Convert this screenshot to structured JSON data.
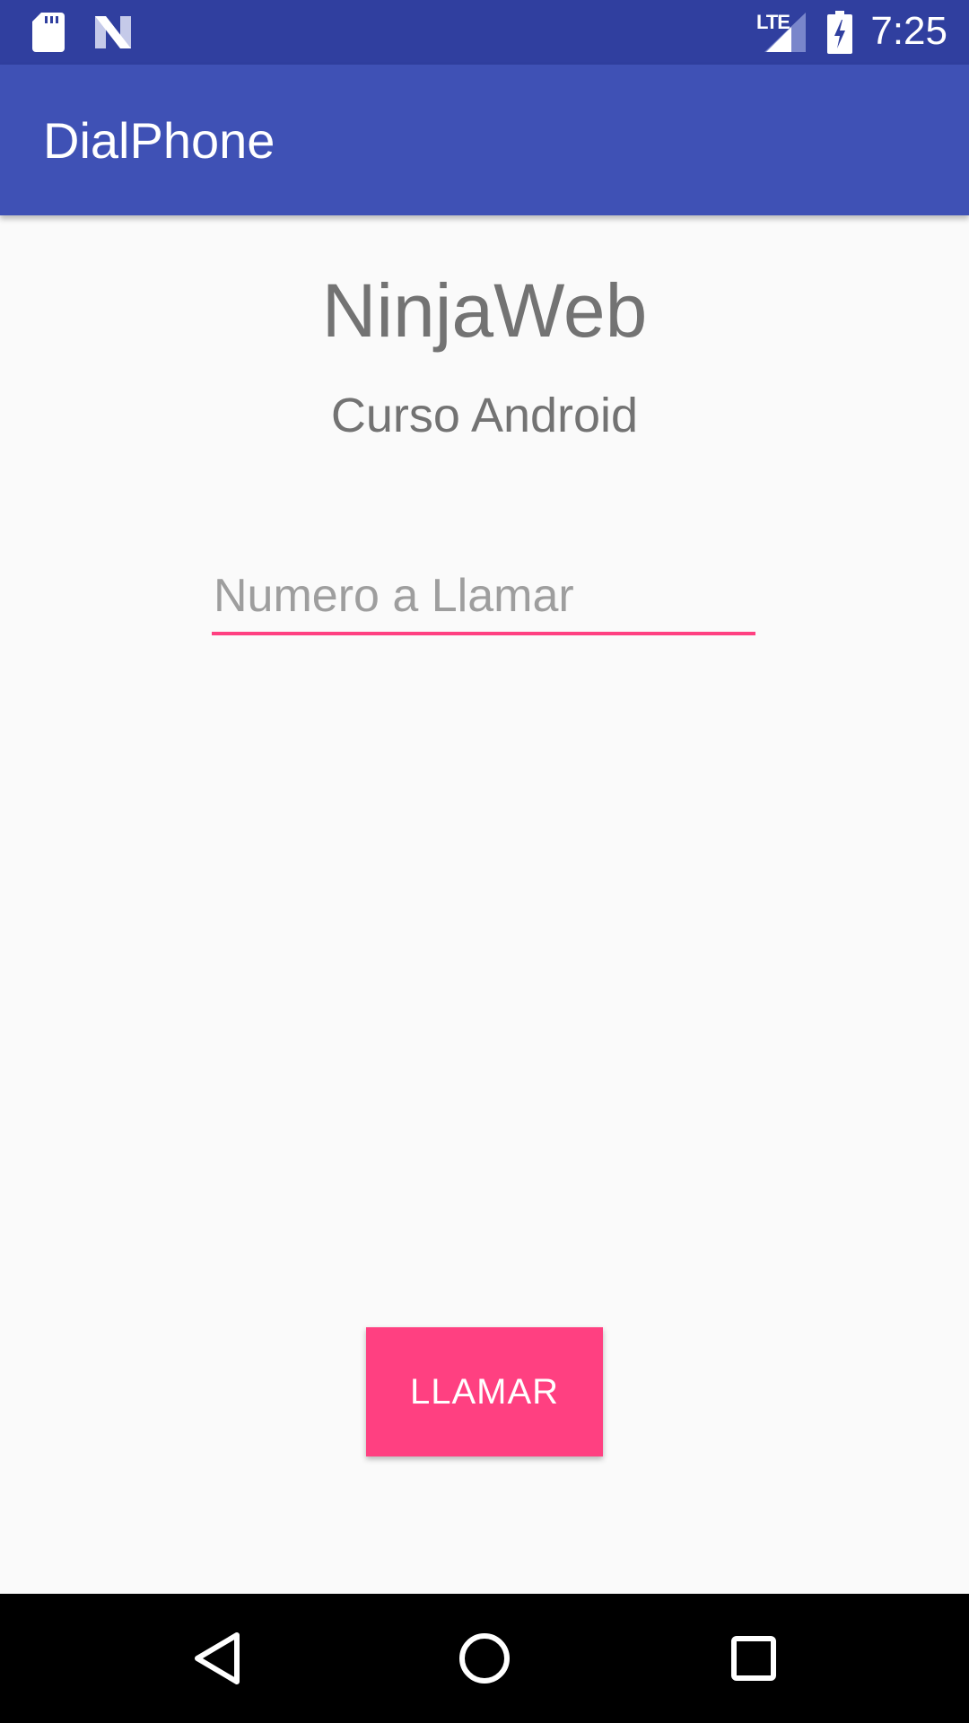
{
  "status_bar": {
    "time": "7:25",
    "network_label": "LTE",
    "icons": [
      "sd-card-icon",
      "n-notification-icon",
      "lte-signal-icon",
      "battery-charging-icon"
    ]
  },
  "app_bar": {
    "title": "DialPhone"
  },
  "main": {
    "heading": "NinjaWeb",
    "subheading": "Curso Android",
    "phone_input": {
      "placeholder": "Numero a Llamar",
      "value": ""
    },
    "call_button_label": "LLAMAR"
  },
  "nav_bar": {
    "icons": [
      "back-icon",
      "home-icon",
      "recents-icon"
    ]
  },
  "colors": {
    "status_bar": "#303f9f",
    "app_bar": "#3f51b5",
    "accent": "#ff4081",
    "text_secondary": "#737373",
    "background": "#fafafa"
  }
}
